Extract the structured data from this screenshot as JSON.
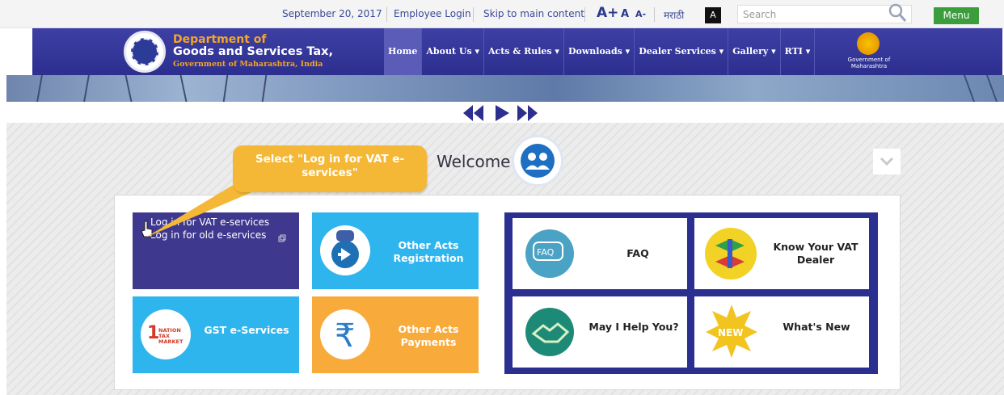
{
  "topbar": {
    "date": "September 20, 2017",
    "employee_login": "Employee Login",
    "skip_link": "Skip to main content",
    "font_increase": "A+",
    "font_normal": "A",
    "font_decrease": "A-",
    "language": "मराठी",
    "contrast": "A",
    "search_placeholder": "Search",
    "menu": "Menu"
  },
  "header": {
    "dept_line1": "Department of",
    "dept_line2": "Goods and Services Tax,",
    "dept_line3": "Government of Maharashtra, India",
    "emblem_text": "Government of Maharashtra",
    "nav": [
      {
        "label": "Home"
      },
      {
        "label": "About Us ▾"
      },
      {
        "label": "Acts & Rules ▾"
      },
      {
        "label": "Downloads ▾"
      },
      {
        "label": "Dealer Services ▾"
      },
      {
        "label": "Gallery ▾"
      },
      {
        "label": "RTI ▾"
      }
    ]
  },
  "welcome": {
    "title": "Welcome",
    "callout": "Select \"Log in for VAT e-services\""
  },
  "tiles": {
    "vat_login": "Log in for VAT e-services",
    "old_login": "Log in for old e-services",
    "other_acts_registration": "Other Acts Registration",
    "gst_eservices": "GST e-Services",
    "gst_logo_text": "NATION TAX MARKET",
    "other_acts_payments": "Other Acts Payments",
    "faq": "FAQ",
    "faq_icon_text": "FAQ",
    "know_dealer": "Know Your VAT Dealer",
    "help": "May I Help You?",
    "whats_new": "What's New",
    "new_badge": "NEW"
  },
  "colors": {
    "nav_bg": "#2d2f8f",
    "accent_orange": "#f5a623",
    "tile_blue": "#2fb5ee",
    "tile_purple": "#3f388f",
    "menu_green": "#3c9d3c"
  }
}
